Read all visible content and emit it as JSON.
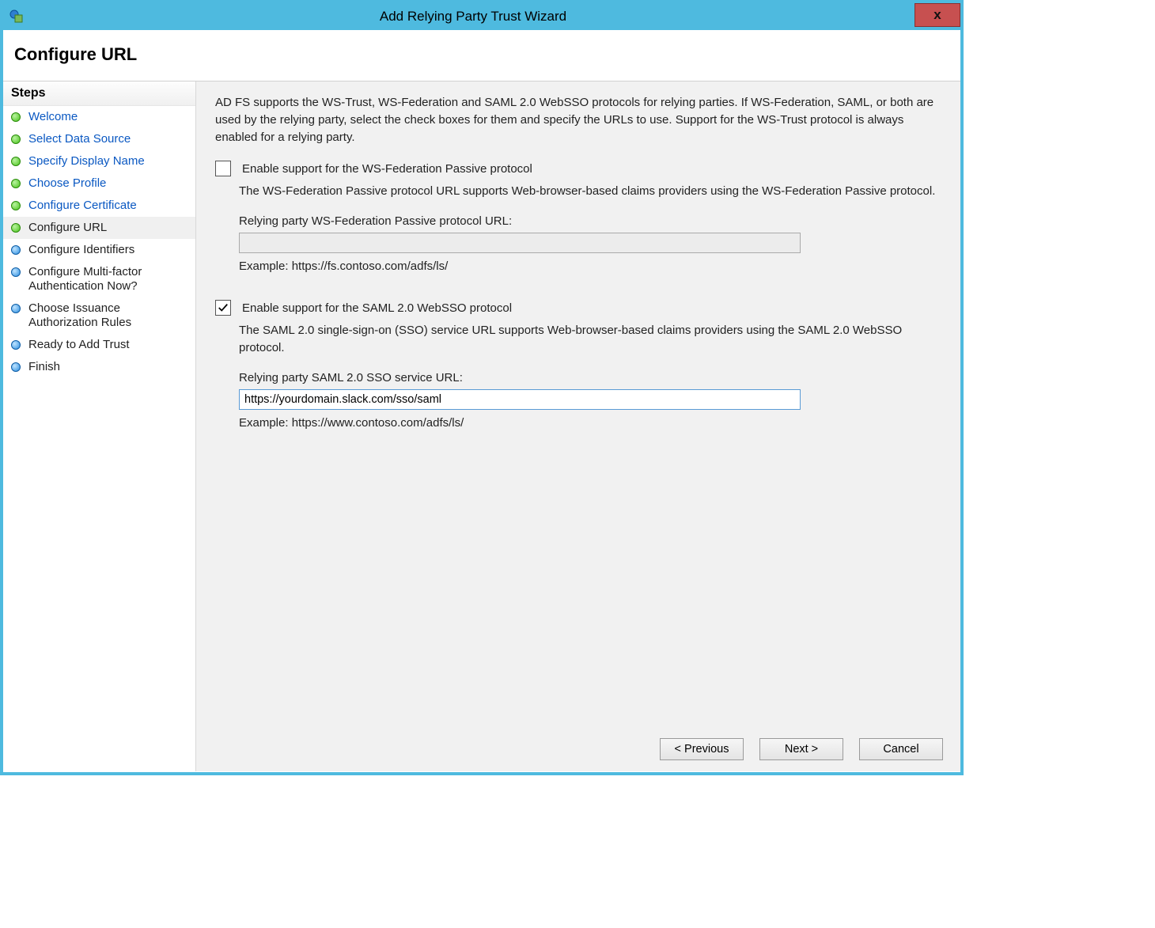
{
  "window": {
    "title": "Add Relying Party Trust Wizard",
    "close_label": "x"
  },
  "header": {
    "title": "Configure URL"
  },
  "sidebar": {
    "title": "Steps",
    "items": [
      {
        "label": "Welcome",
        "state": "done",
        "link": true
      },
      {
        "label": "Select Data Source",
        "state": "done",
        "link": true
      },
      {
        "label": "Specify Display Name",
        "state": "done",
        "link": true
      },
      {
        "label": "Choose Profile",
        "state": "done",
        "link": true
      },
      {
        "label": "Configure Certificate",
        "state": "done",
        "link": true
      },
      {
        "label": "Configure URL",
        "state": "done",
        "link": false,
        "current": true
      },
      {
        "label": "Configure Identifiers",
        "state": "pending",
        "link": false
      },
      {
        "label": "Configure Multi-factor Authentication Now?",
        "state": "pending",
        "link": false
      },
      {
        "label": "Choose Issuance Authorization Rules",
        "state": "pending",
        "link": false
      },
      {
        "label": "Ready to Add Trust",
        "state": "pending",
        "link": false
      },
      {
        "label": "Finish",
        "state": "pending",
        "link": false
      }
    ]
  },
  "content": {
    "intro": "AD FS supports the WS-Trust, WS-Federation and SAML 2.0 WebSSO protocols for relying parties.  If WS-Federation, SAML, or both are used by the relying party, select the check boxes for them and specify the URLs to use.  Support for the WS-Trust protocol is always enabled for a relying party.",
    "wsfed": {
      "checkbox_label": "Enable support for the WS-Federation Passive protocol",
      "checked": false,
      "description": "The WS-Federation Passive protocol URL supports Web-browser-based claims providers using the WS-Federation Passive protocol.",
      "url_label": "Relying party WS-Federation Passive protocol URL:",
      "url_value": "",
      "example": "Example: https://fs.contoso.com/adfs/ls/"
    },
    "saml": {
      "checkbox_label": "Enable support for the SAML 2.0 WebSSO protocol",
      "checked": true,
      "description": "The SAML 2.0 single-sign-on (SSO) service URL supports Web-browser-based claims providers using the SAML 2.0 WebSSO protocol.",
      "url_label": "Relying party SAML 2.0 SSO service URL:",
      "url_value": "https://yourdomain.slack.com/sso/saml",
      "example": "Example: https://www.contoso.com/adfs/ls/"
    }
  },
  "buttons": {
    "previous": "< Previous",
    "next": "Next >",
    "cancel": "Cancel"
  }
}
